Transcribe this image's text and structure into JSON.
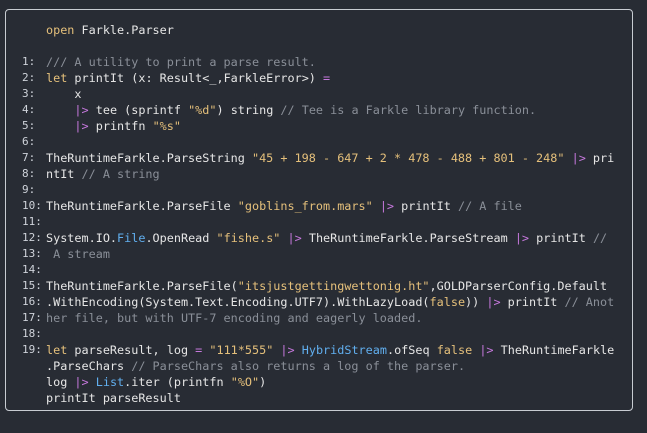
{
  "lines": [
    {
      "num": "",
      "segments": [
        {
          "t": "open",
          "c": "kw"
        },
        {
          "t": " Farkle.Parser",
          "c": ""
        }
      ]
    },
    {
      "num": "",
      "segments": []
    },
    {
      "num": "1:",
      "segments": [
        {
          "t": "/// A utility to print a parse result.",
          "c": "cm"
        }
      ]
    },
    {
      "num": "2:",
      "segments": [
        {
          "t": "let",
          "c": "kw"
        },
        {
          "t": " printIt (x: Result<_,FarkleError>) ",
          "c": ""
        },
        {
          "t": "=",
          "c": "op"
        }
      ]
    },
    {
      "num": "3:",
      "segments": [
        {
          "t": "    x",
          "c": ""
        }
      ]
    },
    {
      "num": "4:",
      "segments": [
        {
          "t": "    ",
          "c": ""
        },
        {
          "t": "|>",
          "c": "op"
        },
        {
          "t": " tee (sprintf ",
          "c": ""
        },
        {
          "t": "\"%d\"",
          "c": "str"
        },
        {
          "t": ") string ",
          "c": ""
        },
        {
          "t": "// Tee is a Farkle library function.",
          "c": "cm"
        }
      ]
    },
    {
      "num": "5:",
      "segments": [
        {
          "t": "    ",
          "c": ""
        },
        {
          "t": "|>",
          "c": "op"
        },
        {
          "t": " printfn ",
          "c": ""
        },
        {
          "t": "\"%s\"",
          "c": "str"
        }
      ]
    },
    {
      "num": "6:",
      "segments": []
    },
    {
      "num": "7:",
      "segments": [
        {
          "t": "TheRuntimeFarkle.ParseString ",
          "c": ""
        },
        {
          "t": "\"45 + 198 - 647 + 2 * 478 - 488 + 801 - 248\"",
          "c": "str"
        },
        {
          "t": " ",
          "c": ""
        },
        {
          "t": "|>",
          "c": "op"
        },
        {
          "t": " pri",
          "c": ""
        }
      ]
    },
    {
      "num": "8:",
      "segments": [
        {
          "t": "ntIt ",
          "c": ""
        },
        {
          "t": "// A string",
          "c": "cm"
        }
      ]
    },
    {
      "num": "9:",
      "segments": []
    },
    {
      "num": "10:",
      "segments": [
        {
          "t": "TheRuntimeFarkle.ParseFile ",
          "c": ""
        },
        {
          "t": "\"goblins_from.mars\"",
          "c": "str"
        },
        {
          "t": " ",
          "c": ""
        },
        {
          "t": "|>",
          "c": "op"
        },
        {
          "t": " printIt ",
          "c": ""
        },
        {
          "t": "// A file",
          "c": "cm"
        }
      ]
    },
    {
      "num": "11:",
      "segments": []
    },
    {
      "num": "12:",
      "segments": [
        {
          "t": "System.IO.",
          "c": ""
        },
        {
          "t": "File",
          "c": "cls"
        },
        {
          "t": ".OpenRead ",
          "c": ""
        },
        {
          "t": "\"fishe.s\"",
          "c": "str"
        },
        {
          "t": " ",
          "c": ""
        },
        {
          "t": "|>",
          "c": "op"
        },
        {
          "t": " TheRuntimeFarkle.ParseStream ",
          "c": ""
        },
        {
          "t": "|>",
          "c": "op"
        },
        {
          "t": " printIt ",
          "c": ""
        },
        {
          "t": "//",
          "c": "cm"
        }
      ]
    },
    {
      "num": "13:",
      "segments": [
        {
          "t": " A stream",
          "c": "cm"
        }
      ]
    },
    {
      "num": "14:",
      "segments": []
    },
    {
      "num": "15:",
      "segments": [
        {
          "t": "TheRuntimeFarkle.ParseFile(",
          "c": ""
        },
        {
          "t": "\"itsjustgettingwettonig.ht\"",
          "c": "str"
        },
        {
          "t": ",GOLDParserConfig.Default",
          "c": ""
        }
      ]
    },
    {
      "num": "16:",
      "segments": [
        {
          "t": ".WithEncoding(System.Text.Encoding.UTF7).WithLazyLoad(",
          "c": ""
        },
        {
          "t": "false",
          "c": "bool"
        },
        {
          "t": ")) ",
          "c": ""
        },
        {
          "t": "|>",
          "c": "op"
        },
        {
          "t": " printIt ",
          "c": ""
        },
        {
          "t": "// Anot",
          "c": "cm"
        }
      ]
    },
    {
      "num": "17:",
      "segments": [
        {
          "t": "her file, but with UTF-7 encoding and eagerly loaded.",
          "c": "cm"
        }
      ]
    },
    {
      "num": "18:",
      "segments": []
    },
    {
      "num": "19:",
      "segments": [
        {
          "t": "let",
          "c": "kw"
        },
        {
          "t": " parseResult, log ",
          "c": ""
        },
        {
          "t": "=",
          "c": "op"
        },
        {
          "t": " ",
          "c": ""
        },
        {
          "t": "\"111*555\"",
          "c": "str"
        },
        {
          "t": " ",
          "c": ""
        },
        {
          "t": "|>",
          "c": "op"
        },
        {
          "t": " ",
          "c": ""
        },
        {
          "t": "HybridStream",
          "c": "cls"
        },
        {
          "t": ".ofSeq ",
          "c": ""
        },
        {
          "t": "false",
          "c": "bool"
        },
        {
          "t": " ",
          "c": ""
        },
        {
          "t": "|>",
          "c": "op"
        },
        {
          "t": " TheRuntimeFarkle",
          "c": ""
        }
      ]
    },
    {
      "num": "",
      "segments": [
        {
          "t": ".ParseChars ",
          "c": ""
        },
        {
          "t": "// ParseChars also returns a log of the parser.",
          "c": "cm"
        }
      ]
    },
    {
      "num": "",
      "segments": [
        {
          "t": "log ",
          "c": ""
        },
        {
          "t": "|>",
          "c": "op"
        },
        {
          "t": " ",
          "c": ""
        },
        {
          "t": "List",
          "c": "cls"
        },
        {
          "t": ".iter (printfn ",
          "c": ""
        },
        {
          "t": "\"%O\"",
          "c": "str"
        },
        {
          "t": ")",
          "c": ""
        }
      ]
    },
    {
      "num": "",
      "segments": [
        {
          "t": "printIt parseResult",
          "c": ""
        }
      ]
    }
  ],
  "colors": {
    "background": "#282c34",
    "keyword": "#e5c07b",
    "string": "#e5c07b",
    "operator": "#c678dd",
    "comment": "#8a8f98",
    "type": "#61afef"
  }
}
